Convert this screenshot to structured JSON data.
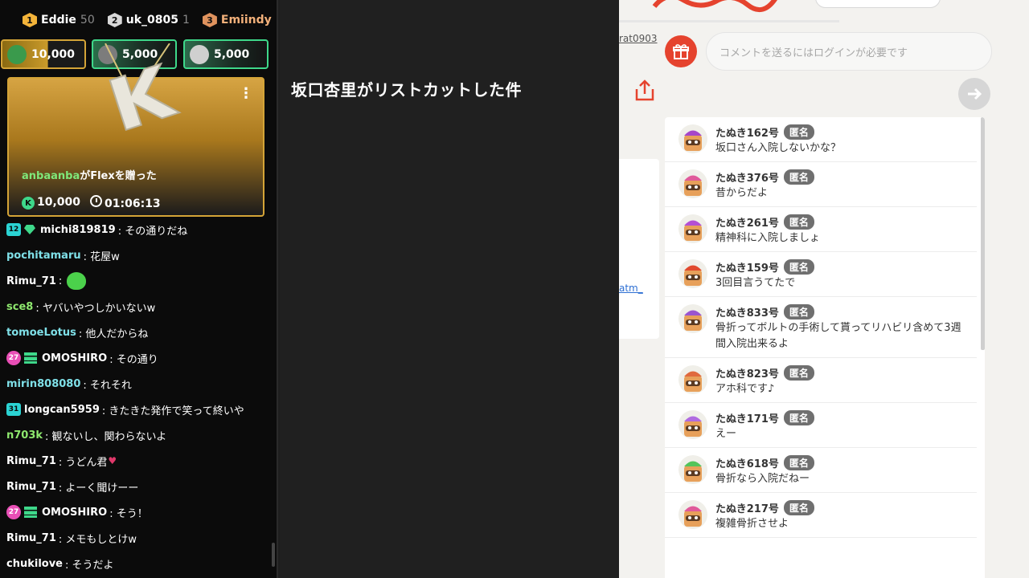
{
  "leaderboard": [
    {
      "rank": "1",
      "name": "Eddie",
      "score": "50"
    },
    {
      "rank": "2",
      "name": "uk_0805",
      "score": "1"
    },
    {
      "rank": "3",
      "name": "Emiindy",
      "score": "1"
    }
  ],
  "gifts": [
    {
      "amount": "10,000"
    },
    {
      "amount": "5,000"
    },
    {
      "amount": "5,000"
    }
  ],
  "alert": {
    "user": "anbaanba",
    "action": "がFlexを贈った",
    "coins": "10,000",
    "time": "01:06:13",
    "menu": "⋮",
    "coin_glyph": "K"
  },
  "chat": [
    {
      "badge_num": "12",
      "badge2": "gem",
      "name": "michi819819",
      "color": "#ffffff",
      "text": ": その通りだね"
    },
    {
      "name": "pochitamaru",
      "color": "#7fe0e8",
      "text": ": 花屋w"
    },
    {
      "name": "Rimu_71",
      "color": "#ffffff",
      "text": ":",
      "emote": true
    },
    {
      "name": "sce8",
      "color": "#8ee86e",
      "text": ": ヤバいやつしかいないw"
    },
    {
      "name": "tomoeLotus",
      "color": "#7fe0e8",
      "text": ": 他人だからね"
    },
    {
      "badge_num": "27",
      "badge_type": "pink",
      "badge2": "stack",
      "name": "OMOSHIRO",
      "color": "#ffffff",
      "text": ": その通り"
    },
    {
      "name": "mirin808080",
      "color": "#7fe0e8",
      "text": ": それそれ"
    },
    {
      "badge_num": "31",
      "name": "longcan5959",
      "color": "#ffffff",
      "text": ": きたきた発作で笑って終いや"
    },
    {
      "name": "n703k",
      "color": "#8ee86e",
      "text": ": 観ないし、関わらないよ"
    },
    {
      "name": "Rimu_71",
      "color": "#ffffff",
      "text": ": うどん君",
      "heart": "♥"
    },
    {
      "name": "Rimu_71",
      "color": "#ffffff",
      "text": ": よーく聞けーー"
    },
    {
      "badge_num": "27",
      "badge_type": "pink",
      "badge2": "stack",
      "name": "OMOSHIRO",
      "color": "#ffffff",
      "text": ": そう！"
    },
    {
      "name": "Rimu_71",
      "color": "#ffffff",
      "text": ": メモもしとけw"
    },
    {
      "name": "chukilove",
      "color": "#ffffff",
      "text": ": そうだよ"
    }
  ],
  "stream_title": "坂口杏里がリストカットした件",
  "right": {
    "user_link": "rat0903",
    "comment_placeholder": "コメントを送るにはログインが必要です",
    "side_link": "atm_",
    "anon_label": "匿名",
    "comments": [
      {
        "user": "たぬき162号",
        "text": "坂口さん入院しないかな？",
        "hat": "#a646c9"
      },
      {
        "user": "たぬき376号",
        "text": "昔からだよ",
        "hat": "#e05a9a"
      },
      {
        "user": "たぬき261号",
        "text": "精神科に入院しましょ",
        "hat": "#b44fd4"
      },
      {
        "user": "たぬき159号",
        "text": "3回目言うてたで",
        "hat": "#e14a2e"
      },
      {
        "user": "たぬき833号",
        "text": "骨折ってボルトの手術して貰ってリハビリ含めて3週間入院出来るよ",
        "hat": "#9a55d0"
      },
      {
        "user": "たぬき823号",
        "text": "アホ科です♪",
        "hat": "#e0693e"
      },
      {
        "user": "たぬき171号",
        "text": "えー",
        "hat": "#b06be0"
      },
      {
        "user": "たぬき618号",
        "text": "骨折なら入院だねー",
        "hat": "#53c45a"
      },
      {
        "user": "たぬき217号",
        "text": "複雑骨折させよ",
        "hat": "#e05a9a"
      }
    ]
  }
}
